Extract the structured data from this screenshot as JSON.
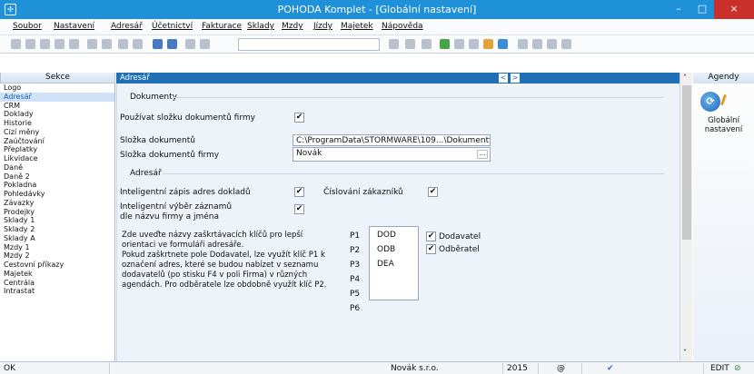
{
  "window": {
    "title": "POHODA Komplet - [Globální nastavení]",
    "minimize": "–",
    "maximize": "□",
    "close": "×"
  },
  "menu": [
    "Soubor",
    "Nastavení",
    "Adresář",
    "Účetnictví",
    "Fakturace",
    "Sklady",
    "Mzdy",
    "Jízdy",
    "Majetek",
    "Nápověda"
  ],
  "sekce": {
    "header": "Sekce",
    "selected": "Adresář",
    "items": [
      "Logo",
      "Adresář",
      "CRM",
      "Doklady",
      "Historie",
      "Cizí měny",
      "Zaúčtování",
      "Přeplatky",
      "Likvidace",
      "Daně",
      "Daně 2",
      "Pokladna",
      "Pohledávky",
      "Závazky",
      "Prodejky",
      "Sklady 1",
      "Sklady 2",
      "Sklady A",
      "Mzdy 1",
      "Mzdy 2",
      "Cestovní příkazy",
      "Majetek",
      "Centrála",
      "Intrastat"
    ]
  },
  "panel": {
    "header": "Adresář",
    "nav_prev": "<",
    "nav_next": ">",
    "dokumenty": {
      "title": "Dokumenty",
      "use_folder_label": "Používat složku dokumentů firmy",
      "use_folder_checked": "✔",
      "folder_label": "Složka dokumentů",
      "folder_value": "C:\\ProgramData\\STORMWARE\\109...\\Dokumenty\\",
      "company_folder_label": "Složka dokumentů firmy",
      "company_folder_value": "Novák",
      "browse_label": "..."
    },
    "adresar": {
      "title": "Adresář",
      "smart_address_label": "Inteligentní zápis adres dokladů",
      "smart_address_checked": "✔",
      "numbering_label": "Číslování zákazníků",
      "numbering_checked": "✔",
      "smart_select_label_1": "Inteligentní výběr záznamů",
      "smart_select_label_2": "dle názvu firmy a jména",
      "smart_select_checked": "✔",
      "help_text_1": "Zde uveďte názvy zaškrtávacích klíčů pro lepší orientaci ve formuláři adresáře.",
      "help_text_2": "Pokud zaškrtnete pole Dodavatel, lze využít klíč P1 k označení adres, které se budou nabízet v seznamu dodavatelů (po stisku F4 v poli Firma) v různých agendách. Pro odběratele lze obdobně využít klíč P2.",
      "keys": [
        {
          "label": "P1",
          "value": "DOD"
        },
        {
          "label": "P2",
          "value": "ODB"
        },
        {
          "label": "P3",
          "value": "DEA"
        },
        {
          "label": "P4",
          "value": ""
        },
        {
          "label": "P5",
          "value": ""
        },
        {
          "label": "P6",
          "value": ""
        }
      ],
      "dodavatel_label": "Dodavatel",
      "dodavatel_checked": "✔",
      "odberatel_label": "Odběratel",
      "odberatel_checked": "✔"
    }
  },
  "agendy": {
    "header": "Agendy",
    "item_line1": "Globální",
    "item_line2": "nastavení"
  },
  "statusbar": {
    "status": "OK",
    "company": "Novák s.r.o.",
    "year": "2015",
    "mode": "EDIT"
  },
  "colors": {
    "titlebar": "#1f91d8",
    "panel_header": "#1e6fb5",
    "selected_item": "#cfe2f7",
    "content_bg": "#eef3fa"
  }
}
